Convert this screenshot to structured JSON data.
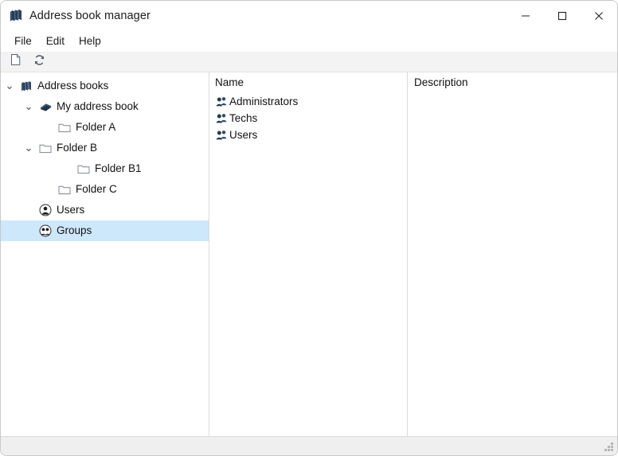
{
  "window": {
    "title": "Address book manager",
    "title_icon": "books-stack-icon",
    "controls": {
      "minimize": "─",
      "maximize": "□",
      "close": "✕"
    }
  },
  "menubar": {
    "items": [
      {
        "label": "File"
      },
      {
        "label": "Edit"
      },
      {
        "label": "Help"
      }
    ]
  },
  "toolbar": {
    "buttons": [
      {
        "name": "new-document-button",
        "icon": "document-icon"
      },
      {
        "name": "refresh-button",
        "icon": "refresh-icon"
      }
    ]
  },
  "tree": {
    "nodes": [
      {
        "label": "Address books",
        "icon": "books-stack-icon",
        "indent": 0,
        "twisty": "⌄",
        "expanded": true,
        "selected": false
      },
      {
        "label": "My address book",
        "icon": "book-icon",
        "indent": 1,
        "twisty": "⌄",
        "expanded": true,
        "selected": false
      },
      {
        "label": "Folder A",
        "icon": "folder-icon",
        "indent": 2,
        "twisty": "",
        "expanded": false,
        "selected": false
      },
      {
        "label": "Folder B",
        "icon": "folder-icon",
        "indent": 2,
        "twisty": "⌄",
        "expanded": true,
        "selected": false
      },
      {
        "label": "Folder B1",
        "icon": "folder-icon",
        "indent": 3,
        "twisty": "",
        "expanded": false,
        "selected": false
      },
      {
        "label": "Folder C",
        "icon": "folder-icon",
        "indent": 2,
        "twisty": "",
        "expanded": false,
        "selected": false
      },
      {
        "label": "Users",
        "icon": "user-circle-icon",
        "indent": 1,
        "twisty": "",
        "expanded": false,
        "selected": false
      },
      {
        "label": "Groups",
        "icon": "group-circle-icon",
        "indent": 1,
        "twisty": "",
        "expanded": false,
        "selected": true
      }
    ]
  },
  "list": {
    "columns": [
      {
        "key": "name",
        "label": "Name"
      },
      {
        "key": "description",
        "label": "Description"
      }
    ],
    "rows": [
      {
        "name": "Administrators",
        "description": "",
        "icon": "group-icon"
      },
      {
        "name": "Techs",
        "description": "",
        "icon": "group-icon"
      },
      {
        "name": "Users",
        "description": "",
        "icon": "group-icon"
      }
    ]
  },
  "statusbar": {
    "text": "",
    "grip": "resize-grip-icon"
  },
  "colors": {
    "selection": "#cde8fa",
    "icon_navy": "#243b58",
    "window_bg": "#ffffff",
    "toolbar_bg": "#f3f3f3",
    "statusbar_bg": "#efefef",
    "divider": "#dcdcdc"
  }
}
